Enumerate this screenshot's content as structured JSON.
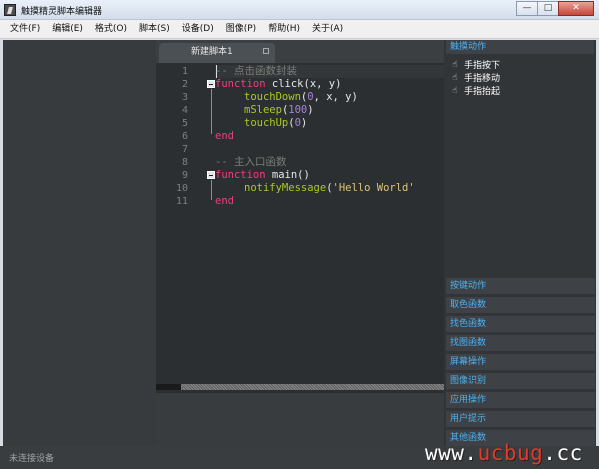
{
  "window": {
    "title": "触摸精灵脚本编辑器",
    "buttons": {
      "minimize": "—",
      "maximize": "□",
      "close": "✕"
    }
  },
  "menu": [
    "文件(F)",
    "编辑(E)",
    "格式(O)",
    "脚本(S)",
    "设备(D)",
    "图像(P)",
    "帮助(H)",
    "关于(A)"
  ],
  "editor": {
    "tab_label": "新建脚本1",
    "line_numbers": [
      "1",
      "2",
      "3",
      "4",
      "5",
      "6",
      "7",
      "8",
      "9",
      "10",
      "11"
    ],
    "code": {
      "l1_comment": "-- 点击函数封装",
      "l2_kw": "function",
      "l2_rest": " click(x, y)",
      "l3_fn": "touchDown",
      "l3_a": "(",
      "l3_num": "0",
      "l3_b": ", x, y)",
      "l4_fn": "mSleep",
      "l4_a": "(",
      "l4_num": "100",
      "l4_b": ")",
      "l5_fn": "touchUp",
      "l5_a": "(",
      "l5_num": "0",
      "l5_b": ")",
      "l6_kw": "end",
      "l8_comment": "-- 主入口函数",
      "l9_kw": "function",
      "l9_rest": " main()",
      "l10_fn": "notifyMessage",
      "l10_a": "(",
      "l10_str": "'Hello World'",
      "l11_kw": "end"
    }
  },
  "right_panel": {
    "header": "触摸动作",
    "gestures": [
      "手指按下",
      "手指移动",
      "手指抬起"
    ],
    "categories": [
      "按键动作",
      "取色函数",
      "找色函数",
      "找图函数",
      "屏幕操作",
      "图像识别",
      "应用操作",
      "用户提示",
      "其他函数"
    ]
  },
  "status": {
    "text": "未连接设备"
  },
  "watermark": {
    "pre": "www.",
    "accent": "ucbug",
    "post": ".cc"
  }
}
